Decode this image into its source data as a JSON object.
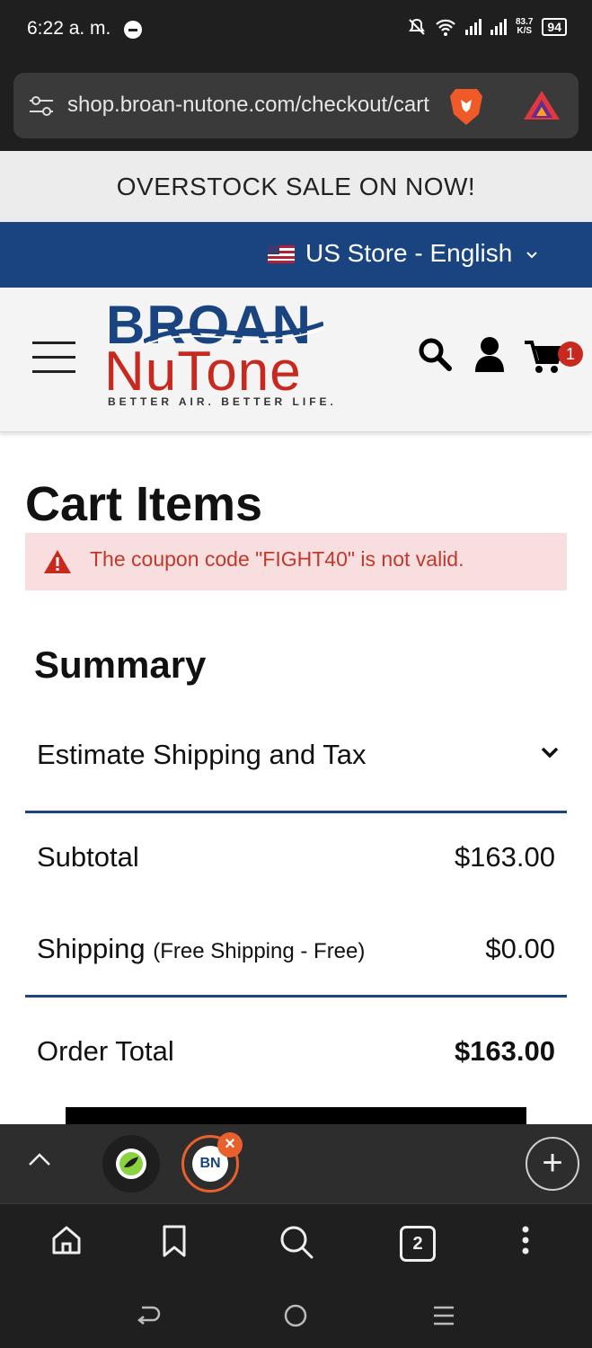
{
  "status_bar": {
    "time": "6:22 a. m.",
    "speed_value": "83.7",
    "speed_unit": "K/S",
    "battery": "94"
  },
  "browser": {
    "url": "shop.broan-nutone.com/checkout/cart"
  },
  "promo": {
    "text": "OVERSTOCK SALE ON NOW!"
  },
  "store": {
    "label": "US Store - English"
  },
  "header": {
    "logo_top": "BROAN",
    "logo_bottom": "NuTone",
    "tagline": "BETTER AIR. BETTER LIFE.",
    "cart_count": "1"
  },
  "cart": {
    "title": "Cart Items",
    "alert": "The coupon code \"FIGHT40\" is not valid."
  },
  "summary": {
    "title": "Summary",
    "estimate_label": "Estimate Shipping and Tax",
    "subtotal_label": "Subtotal",
    "subtotal_value": "$163.00",
    "shipping_label": "Shipping",
    "shipping_detail": "(Free Shipping - Free)",
    "shipping_value": "$0.00",
    "total_label": "Order Total",
    "total_value": "$163.00"
  },
  "tabs": {
    "count": "2",
    "tab2_badge": "BN"
  },
  "colors": {
    "brand_blue": "#1a4480",
    "brand_red": "#c8281e",
    "alert_bg": "#f8dede",
    "alert_text": "#c0392b"
  }
}
